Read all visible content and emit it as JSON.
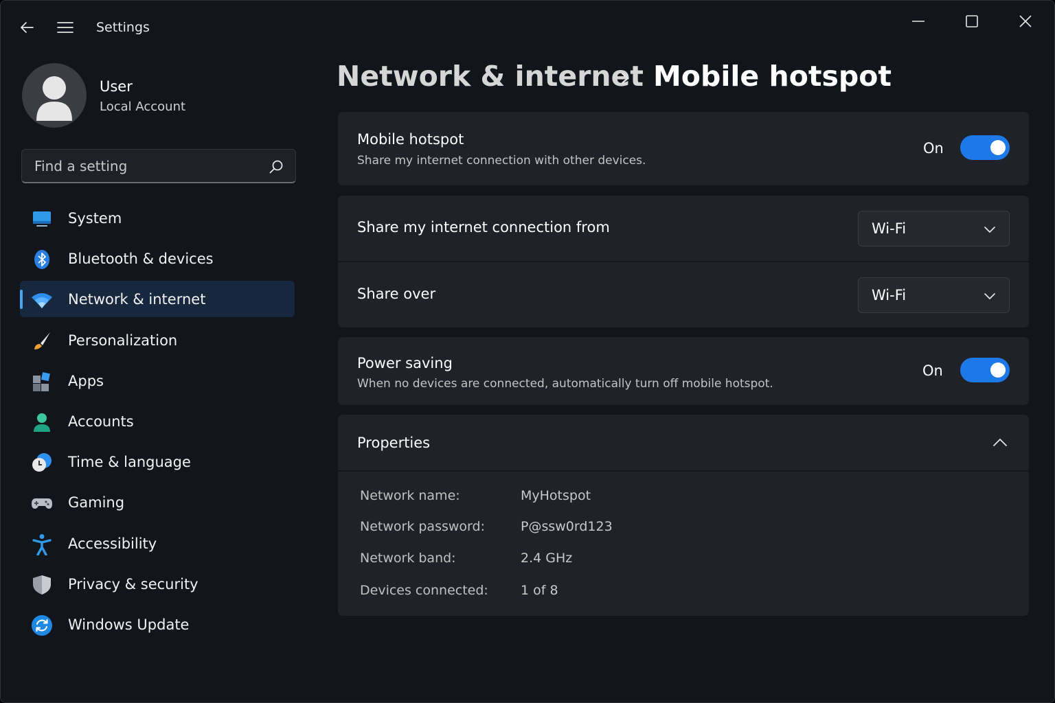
{
  "app": {
    "title": "Settings"
  },
  "user": {
    "name": "User",
    "account_type": "Local Account"
  },
  "search": {
    "placeholder": "Find a setting"
  },
  "sidebar": {
    "items": [
      {
        "label": "System",
        "icon": "system-icon"
      },
      {
        "label": "Bluetooth & devices",
        "icon": "bluetooth-icon"
      },
      {
        "label": "Network & internet",
        "icon": "wifi-icon",
        "active": true
      },
      {
        "label": "Personalization",
        "icon": "paintbrush-icon"
      },
      {
        "label": "Apps",
        "icon": "apps-icon"
      },
      {
        "label": "Accounts",
        "icon": "accounts-icon"
      },
      {
        "label": "Time & language",
        "icon": "time-language-icon"
      },
      {
        "label": "Gaming",
        "icon": "gamepad-icon"
      },
      {
        "label": "Accessibility",
        "icon": "accessibility-icon"
      },
      {
        "label": "Privacy & security",
        "icon": "shield-icon"
      },
      {
        "label": "Windows Update",
        "icon": "update-icon"
      }
    ]
  },
  "breadcrumb": {
    "parent": "Network & internet",
    "current": "Mobile hotspot"
  },
  "hotspot": {
    "title": "Mobile hotspot",
    "description": "Share my internet connection with other devices.",
    "state": "On"
  },
  "share_from": {
    "label": "Share my internet connection from",
    "value": "Wi-Fi"
  },
  "share_over": {
    "label": "Share over",
    "value": "Wi-Fi"
  },
  "power_saving": {
    "title": "Power saving",
    "description": "When no devices are connected, automatically turn off mobile hotspot.",
    "state": "On"
  },
  "properties": {
    "title": "Properties",
    "rows": [
      {
        "label": "Network name:",
        "value": "MyHotspot"
      },
      {
        "label": "Network password:",
        "value": "P@ssw0rd123"
      },
      {
        "label": "Network band:",
        "value": "2.4 GHz"
      },
      {
        "label": "Devices connected:",
        "value": "1 of 8"
      }
    ]
  },
  "colors": {
    "accent": "#1e79e8",
    "window_bg": "#12151c",
    "card_bg": "#1f2229",
    "nav_active_bg": "#17273d"
  }
}
